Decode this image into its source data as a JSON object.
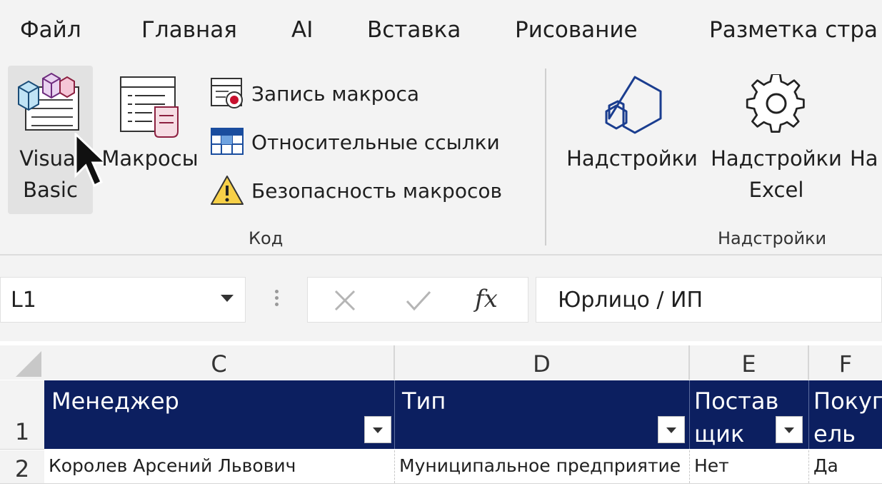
{
  "menu": {
    "tabs": [
      "Файл",
      "Главная",
      "AI",
      "Вставка",
      "Рисование",
      "Разметка стра"
    ]
  },
  "ribbon": {
    "visual_basic_label_line1": "Visual",
    "visual_basic_label_line2": "Basic",
    "macros_label": "Макросы",
    "record_macro_label": "Запись макроса",
    "relative_refs_label": "Относительные ссылки",
    "macro_security_label": "Безопасность макросов",
    "code_group_label": "Код",
    "addins_label": "Надстройки",
    "excel_addins_line1": "Надстройки",
    "excel_addins_line2": "Excel",
    "cut_addins_label": "На",
    "addins_group_label": "Надстройки"
  },
  "formula_bar": {
    "name_box": "L1",
    "fx_label": "fx",
    "value": "Юрлицо / ИП"
  },
  "sheet": {
    "columns": [
      "C",
      "D",
      "E",
      "F"
    ],
    "rows": [
      "1",
      "2"
    ],
    "header": {
      "c_line1": "Менеджер",
      "d_line1": "Тип",
      "e_line1": "Постав",
      "e_line2": "щик",
      "f_line1": "Покуп",
      "f_line2": "ель"
    },
    "row2": [
      "Королев Арсений Львович",
      "Муниципальное предприятие",
      "Нет",
      "Да"
    ]
  },
  "colors": {
    "header_fill": "#0c1f60",
    "ribbon_bg": "#f3f3f3"
  }
}
